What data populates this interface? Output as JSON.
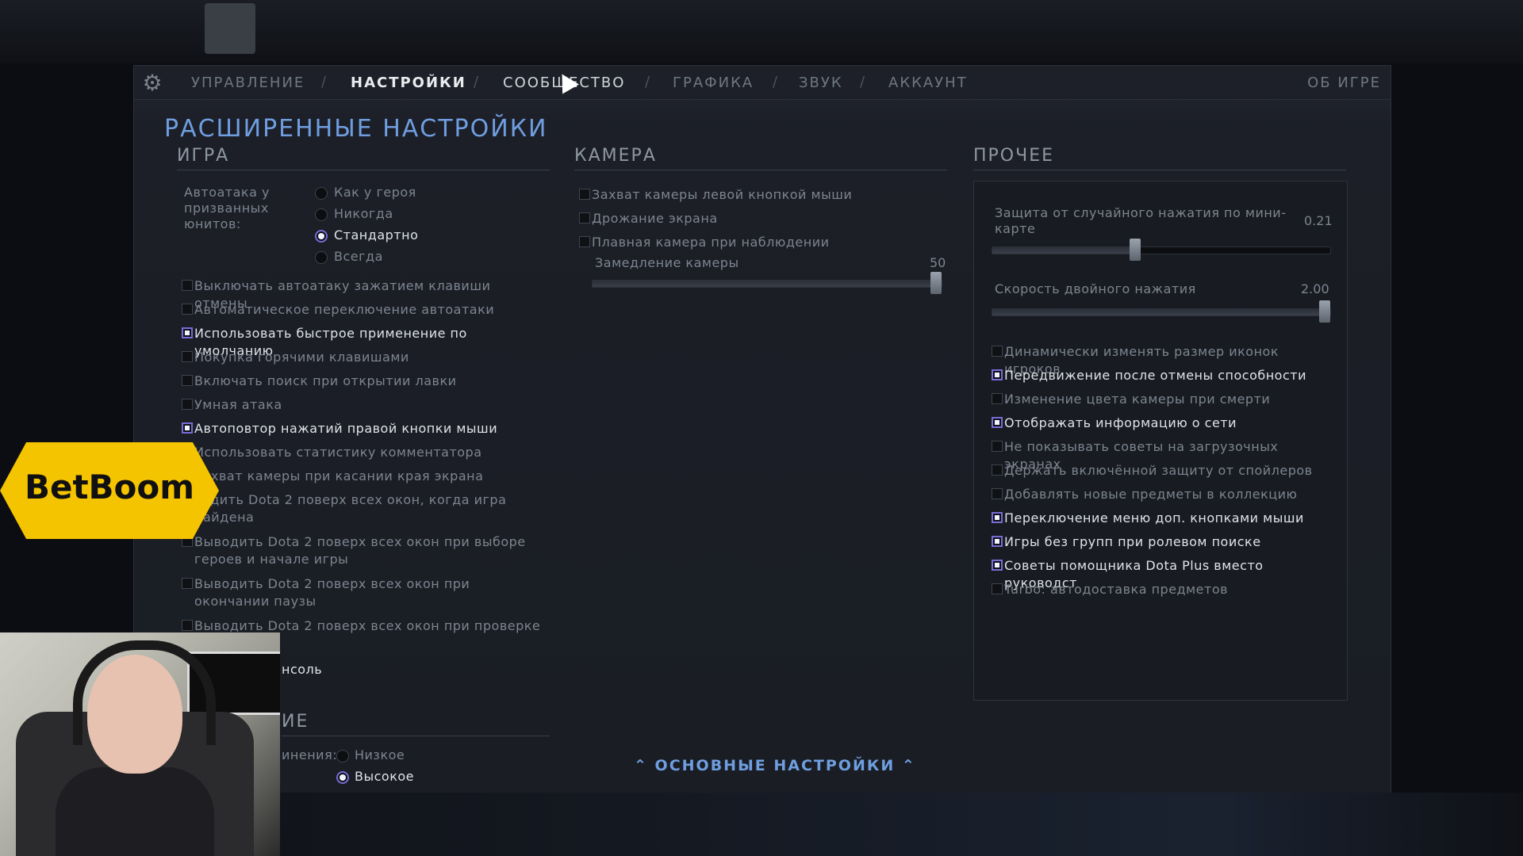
{
  "tabs": [
    "УПРАВЛЕНИЕ",
    "НАСТРОЙКИ",
    "СООБЩЕСТВО",
    "ГРАФИКА",
    "ЗВУК",
    "АККАУНТ"
  ],
  "active_tab": "НАСТРОЙКИ",
  "about": "ОБ ИГРЕ",
  "page_title": "РАСШИРЕННЫЕ НАСТРОЙКИ",
  "game": {
    "title": "ИГРА",
    "autoattack_label": "Автоатака у призванных юнитов:",
    "autoattack_options": [
      "Как у героя",
      "Никогда",
      "Стандартно",
      "Всегда"
    ],
    "autoattack_selected": "Стандартно",
    "checkboxes": [
      {
        "label": "Выключать автоатаку зажатием клавиши отмены",
        "checked": false
      },
      {
        "label": "Автоматическое переключение автоатаки",
        "checked": false
      },
      {
        "label": "Использовать быстрое применение по умолчанию",
        "checked": true
      },
      {
        "label": "Покупка горячими клавишами",
        "checked": false
      },
      {
        "label": "Включать поиск при открытии лавки",
        "checked": false
      },
      {
        "label": "Умная атака",
        "checked": false
      },
      {
        "label": "Автоповтор нажатий правой кнопки мыши",
        "checked": true
      },
      {
        "label": "Использовать статистику комментатора",
        "checked": false
      },
      {
        "label": "рехват камеры при касании края экрана",
        "checked": false
      },
      {
        "label": "водить Dota 2 поверх всех окон, когда игра найдена",
        "checked": false
      },
      {
        "label": "Выводить Dota 2 поверх всех окон при выборе героев и начале игры",
        "checked": false
      },
      {
        "label": "Выводить Dota 2 поверх всех окон при окончании паузы",
        "checked": false
      },
      {
        "label": "Выводить Dota 2 поверх всех окон при проверке",
        "checked": false
      }
    ],
    "console_label": "нсоль",
    "section2_title": "ИЕ",
    "quality_label": "инения:",
    "quality_options": [
      "Низкое",
      "Высокое"
    ],
    "quality_selected": "Высокое"
  },
  "camera": {
    "title": "КАМЕРА",
    "checkboxes": [
      {
        "label": "Захват камеры левой кнопкой мыши",
        "checked": false
      },
      {
        "label": "Дрожание экрана",
        "checked": false
      },
      {
        "label": "Плавная камера при наблюдении",
        "checked": false
      }
    ],
    "slow_label": "Замедление камеры",
    "slow_value": "50",
    "slow_fraction": 1.0
  },
  "other": {
    "title": "ПРОЧЕЕ",
    "minimap_label": "Защита от случайного нажатия по мини-карте",
    "minimap_value": "0.21",
    "minimap_fraction": 0.42,
    "doubletap_label": "Скорость двойного нажатия",
    "doubletap_value": "2.00",
    "doubletap_fraction": 1.0,
    "checkboxes": [
      {
        "label": "Динамически изменять размер иконок игроков",
        "checked": false
      },
      {
        "label": "Передвижение после отмены способности",
        "checked": true
      },
      {
        "label": "Изменение цвета камеры при смерти",
        "checked": false
      },
      {
        "label": "Отображать информацию о сети",
        "checked": true
      },
      {
        "label": "Не показывать советы на загрузочных экранах",
        "checked": false
      },
      {
        "label": "Держать включённой защиту от спойлеров",
        "checked": false
      },
      {
        "label": "Добавлять новые предметы в коллекцию",
        "checked": false
      },
      {
        "label": "Переключение меню доп. кнопками мыши",
        "checked": true
      },
      {
        "label": "Игры без групп при ролевом поиске",
        "checked": true
      },
      {
        "label": "Советы помощника Dota Plus вместо руководст",
        "checked": true
      },
      {
        "label": "Turbo: автодоставка предметов",
        "checked": false
      }
    ]
  },
  "basic_link": "ОСНОВНЫЕ НАСТРОЙКИ",
  "betboom": "BetBoom"
}
